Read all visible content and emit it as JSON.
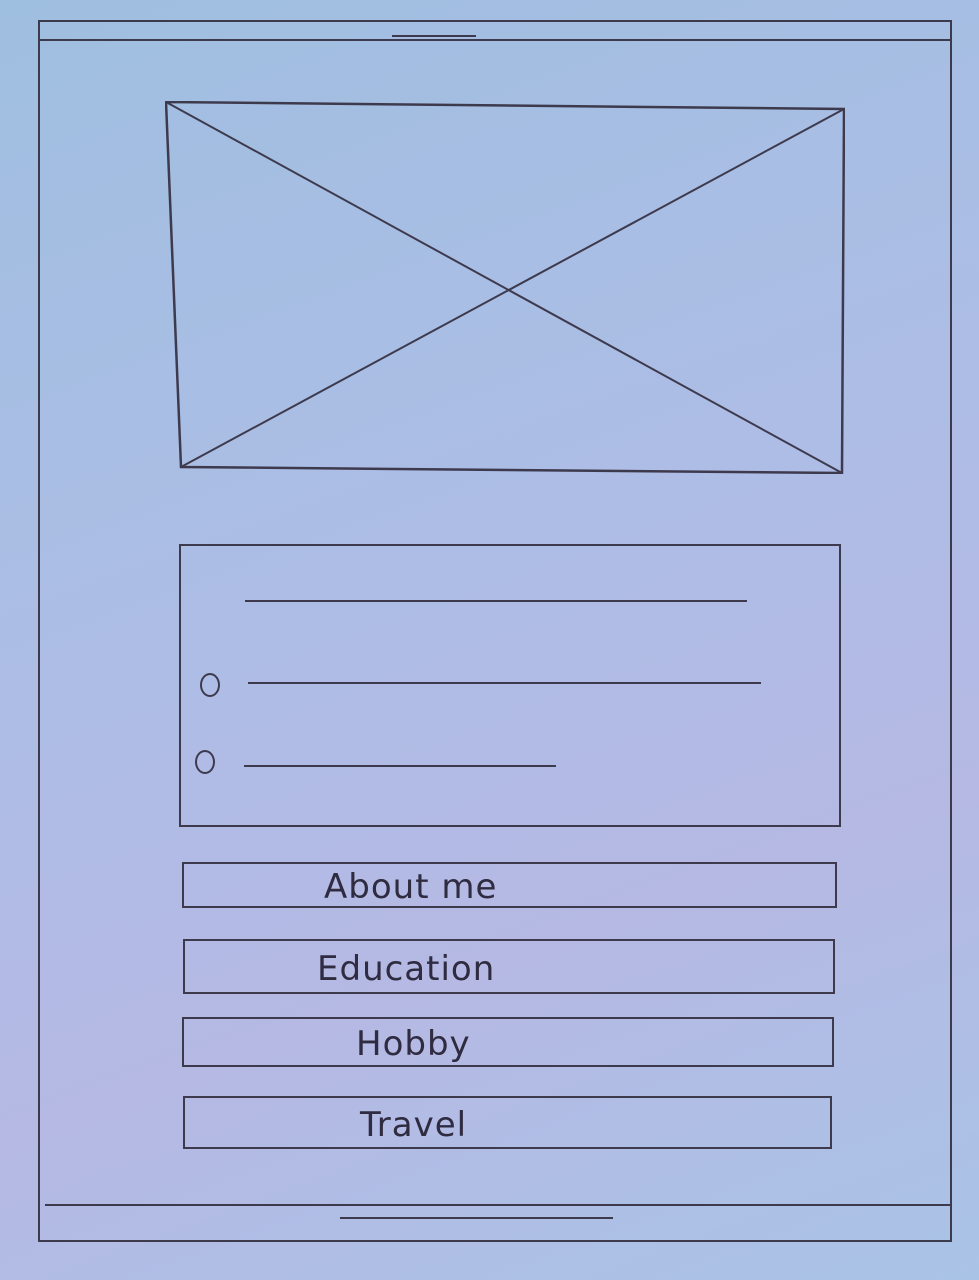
{
  "colors": {
    "paper": "#aebde6",
    "ink": "#3e3a4e"
  },
  "hero": {
    "icon": "image-placeholder-icon"
  },
  "info_card": {
    "bullet_icon": "circle-bullet-icon"
  },
  "nav": {
    "items": [
      {
        "label": "About me"
      },
      {
        "label": "Education"
      },
      {
        "label": "Hobby"
      },
      {
        "label": "Travel"
      }
    ]
  }
}
